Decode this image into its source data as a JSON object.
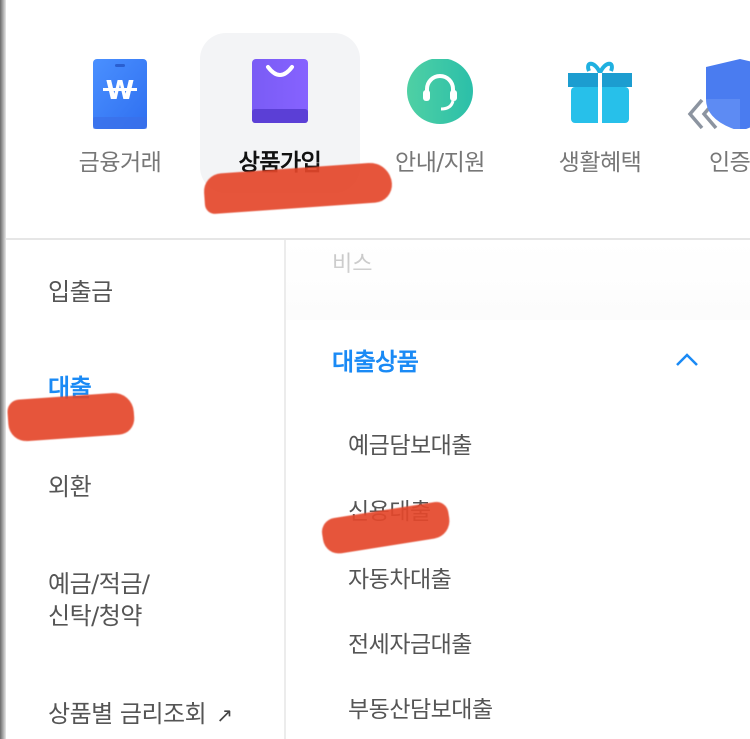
{
  "top_nav": {
    "items": [
      {
        "label": "금융거래",
        "icon": "wallet-won-icon",
        "active": false
      },
      {
        "label": "상품가입",
        "icon": "shopping-bag-icon",
        "active": true
      },
      {
        "label": "안내/지원",
        "icon": "headset-icon",
        "active": false
      },
      {
        "label": "생활혜택",
        "icon": "gift-icon",
        "active": false
      },
      {
        "label": "인증",
        "icon": "shield-icon",
        "active": false
      }
    ],
    "scroll_icon": "double-chevron-left-icon"
  },
  "left_menu": {
    "items": [
      {
        "label": "입출금",
        "active": false
      },
      {
        "label": "대출",
        "active": true
      },
      {
        "label": "외환",
        "active": false
      },
      {
        "label": "예금/적금/",
        "label2": "신탁/청약",
        "active": false
      },
      {
        "label": "상품별 금리조회",
        "external_icon": "↗",
        "active": false
      }
    ]
  },
  "right_panel": {
    "faded_text": "비스",
    "section_title": "대출상품",
    "section_expanded": true,
    "items": [
      "예금담보대출",
      "신용대출",
      "자동차대출",
      "전세자금대출",
      "부동산담보대출"
    ]
  },
  "colors": {
    "accent": "#1a8af5",
    "annotation": "#e4472b"
  }
}
